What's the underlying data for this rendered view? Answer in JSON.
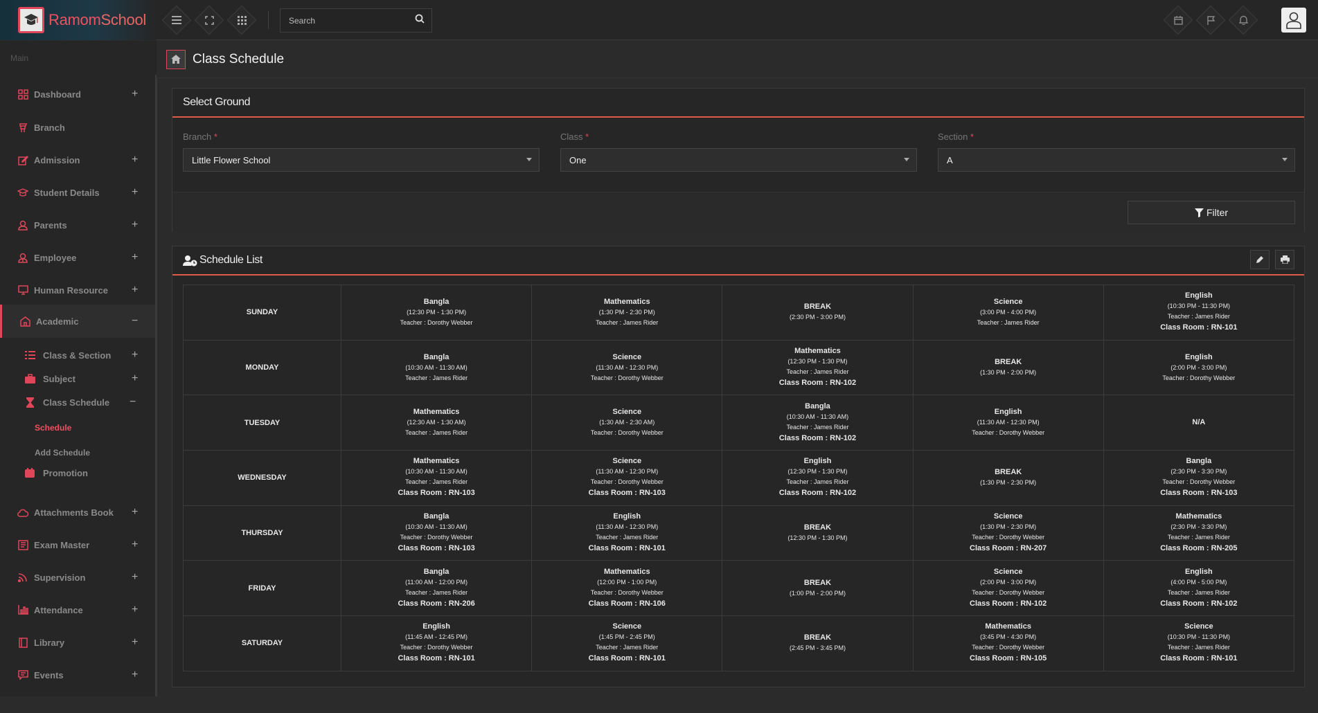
{
  "brand": {
    "name_a": "Ramom",
    "name_b": "School"
  },
  "topbar": {
    "search_placeholder": "Search"
  },
  "sidebar": {
    "section_label": "Main",
    "items": [
      {
        "label": "Dashboard",
        "icon": "dashboard-icon",
        "expand": "+"
      },
      {
        "label": "Branch",
        "icon": "branch-icon",
        "expand": ""
      },
      {
        "label": "Admission",
        "icon": "edit-icon",
        "expand": "+"
      },
      {
        "label": "Student Details",
        "icon": "graduation-cap-icon",
        "expand": "+"
      },
      {
        "label": "Parents",
        "icon": "user-icon",
        "expand": "+"
      },
      {
        "label": "Employee",
        "icon": "user-tie-icon",
        "expand": "+"
      },
      {
        "label": "Human Resource",
        "icon": "monitor-icon",
        "expand": "+"
      },
      {
        "label": "Academic",
        "icon": "academic-icon",
        "expand": "−"
      }
    ],
    "academic_sub": [
      {
        "label": "Class & Section",
        "icon": "list-icon",
        "expand": "+"
      },
      {
        "label": "Subject",
        "icon": "briefcase-icon",
        "expand": "+"
      },
      {
        "label": "Class Schedule",
        "icon": "hourglass-icon",
        "expand": "−"
      }
    ],
    "schedule_sub": [
      {
        "label": "Schedule"
      },
      {
        "label": "Add Schedule"
      }
    ],
    "promotion": {
      "label": "Promotion",
      "icon": "promotion-icon"
    },
    "items_after": [
      {
        "label": "Attachments Book",
        "icon": "cloud-icon",
        "expand": "+"
      },
      {
        "label": "Exam Master",
        "icon": "book-icon",
        "expand": "+"
      },
      {
        "label": "Supervision",
        "icon": "rss-icon",
        "expand": "+"
      },
      {
        "label": "Attendance",
        "icon": "bar-chart-icon",
        "expand": "+"
      },
      {
        "label": "Library",
        "icon": "library-icon",
        "expand": "+"
      },
      {
        "label": "Events",
        "icon": "comment-icon",
        "expand": "+"
      }
    ]
  },
  "page": {
    "title": "Class Schedule"
  },
  "select_ground": {
    "title": "Select Ground",
    "branch_label": "Branch",
    "branch_value": "Little Flower School",
    "class_label": "Class",
    "class_value": "One",
    "section_label": "Section",
    "section_value": "A",
    "required_mark": "*",
    "filter_label": "Filter"
  },
  "schedule_list": {
    "title": "Schedule List",
    "rows": [
      {
        "day": "SUNDAY",
        "cells": [
          {
            "subject": "Bangla",
            "time": "(12:30 PM - 1:30 PM)",
            "teacher": "Teacher : Dorothy Webber",
            "room": ""
          },
          {
            "subject": "Mathematics",
            "time": "(1:30 PM - 2:30 PM)",
            "teacher": "Teacher : James Rider",
            "room": ""
          },
          {
            "subject": "BREAK",
            "time": "(2:30 PM - 3:00 PM)",
            "teacher": "",
            "room": ""
          },
          {
            "subject": "Science",
            "time": "(3:00 PM - 4:00 PM)",
            "teacher": "Teacher : James Rider",
            "room": ""
          },
          {
            "subject": "English",
            "time": "(10:30 PM - 11:30 PM)",
            "teacher": "Teacher : James Rider",
            "room": "Class Room : RN-101"
          }
        ]
      },
      {
        "day": "MONDAY",
        "cells": [
          {
            "subject": "Bangla",
            "time": "(10:30 AM - 11:30 AM)",
            "teacher": "Teacher : James Rider",
            "room": ""
          },
          {
            "subject": "Science",
            "time": "(11:30 AM - 12:30 PM)",
            "teacher": "Teacher : Dorothy Webber",
            "room": ""
          },
          {
            "subject": "Mathematics",
            "time": "(12:30 PM - 1:30 PM)",
            "teacher": "Teacher : James Rider",
            "room": "Class Room : RN-102"
          },
          {
            "subject": "BREAK",
            "time": "(1:30 PM - 2:00 PM)",
            "teacher": "",
            "room": ""
          },
          {
            "subject": "English",
            "time": "(2:00 PM - 3:00 PM)",
            "teacher": "Teacher : Dorothy Webber",
            "room": ""
          }
        ]
      },
      {
        "day": "TUESDAY",
        "cells": [
          {
            "subject": "Mathematics",
            "time": "(12:30 AM - 1:30 AM)",
            "teacher": "Teacher : James Rider",
            "room": ""
          },
          {
            "subject": "Science",
            "time": "(1:30 AM - 2:30 AM)",
            "teacher": "Teacher : Dorothy Webber",
            "room": ""
          },
          {
            "subject": "Bangla",
            "time": "(10:30 AM - 11:30 AM)",
            "teacher": "Teacher : James Rider",
            "room": "Class Room : RN-102"
          },
          {
            "subject": "English",
            "time": "(11:30 AM - 12:30 PM)",
            "teacher": "Teacher : Dorothy Webber",
            "room": ""
          },
          {
            "subject": "N/A",
            "time": "",
            "teacher": "",
            "room": ""
          }
        ]
      },
      {
        "day": "WEDNESDAY",
        "cells": [
          {
            "subject": "Mathematics",
            "time": "(10:30 AM - 11:30 AM)",
            "teacher": "Teacher : James Rider",
            "room": "Class Room : RN-103"
          },
          {
            "subject": "Science",
            "time": "(11:30 AM - 12:30 PM)",
            "teacher": "Teacher : Dorothy Webber",
            "room": "Class Room : RN-103"
          },
          {
            "subject": "English",
            "time": "(12:30 PM - 1:30 PM)",
            "teacher": "Teacher : James Rider",
            "room": "Class Room : RN-102"
          },
          {
            "subject": "BREAK",
            "time": "(1:30 PM - 2:30 PM)",
            "teacher": "",
            "room": ""
          },
          {
            "subject": "Bangla",
            "time": "(2:30 PM - 3:30 PM)",
            "teacher": "Teacher : Dorothy Webber",
            "room": "Class Room : RN-103"
          }
        ]
      },
      {
        "day": "THURSDAY",
        "cells": [
          {
            "subject": "Bangla",
            "time": "(10:30 AM - 11:30 AM)",
            "teacher": "Teacher : Dorothy Webber",
            "room": "Class Room : RN-103"
          },
          {
            "subject": "English",
            "time": "(11:30 AM - 12:30 PM)",
            "teacher": "Teacher : James Rider",
            "room": "Class Room : RN-101"
          },
          {
            "subject": "BREAK",
            "time": "(12:30 PM - 1:30 PM)",
            "teacher": "",
            "room": ""
          },
          {
            "subject": "Science",
            "time": "(1:30 PM - 2:30 PM)",
            "teacher": "Teacher : Dorothy Webber",
            "room": "Class Room : RN-207"
          },
          {
            "subject": "Mathematics",
            "time": "(2:30 PM - 3:30 PM)",
            "teacher": "Teacher : James Rider",
            "room": "Class Room : RN-205"
          }
        ]
      },
      {
        "day": "FRIDAY",
        "cells": [
          {
            "subject": "Bangla",
            "time": "(11:00 AM - 12:00 PM)",
            "teacher": "Teacher : James Rider",
            "room": "Class Room : RN-206"
          },
          {
            "subject": "Mathematics",
            "time": "(12:00 PM - 1:00 PM)",
            "teacher": "Teacher : Dorothy Webber",
            "room": "Class Room : RN-106"
          },
          {
            "subject": "BREAK",
            "time": "(1:00 PM - 2:00 PM)",
            "teacher": "",
            "room": ""
          },
          {
            "subject": "Science",
            "time": "(2:00 PM - 3:00 PM)",
            "teacher": "Teacher : Dorothy Webber",
            "room": "Class Room : RN-102"
          },
          {
            "subject": "English",
            "time": "(4:00 PM - 5:00 PM)",
            "teacher": "Teacher : James Rider",
            "room": "Class Room : RN-102"
          }
        ]
      },
      {
        "day": "SATURDAY",
        "cells": [
          {
            "subject": "English",
            "time": "(11:45 AM - 12:45 PM)",
            "teacher": "Teacher : Dorothy Webber",
            "room": "Class Room : RN-101"
          },
          {
            "subject": "Science",
            "time": "(1:45 PM - 2:45 PM)",
            "teacher": "Teacher : James Rider",
            "room": "Class Room : RN-101"
          },
          {
            "subject": "BREAK",
            "time": "(2:45 PM - 3:45 PM)",
            "teacher": "",
            "room": ""
          },
          {
            "subject": "Mathematics",
            "time": "(3:45 PM - 4:30 PM)",
            "teacher": "Teacher : Dorothy Webber",
            "room": "Class Room : RN-105"
          },
          {
            "subject": "Science",
            "time": "(10:30 PM - 11:30 PM)",
            "teacher": "Teacher : James Rider",
            "room": "Class Room : RN-101"
          }
        ]
      }
    ]
  },
  "colors": {
    "accent": "#e0465a",
    "background": "#2b2b2b",
    "panel": "#262626"
  }
}
